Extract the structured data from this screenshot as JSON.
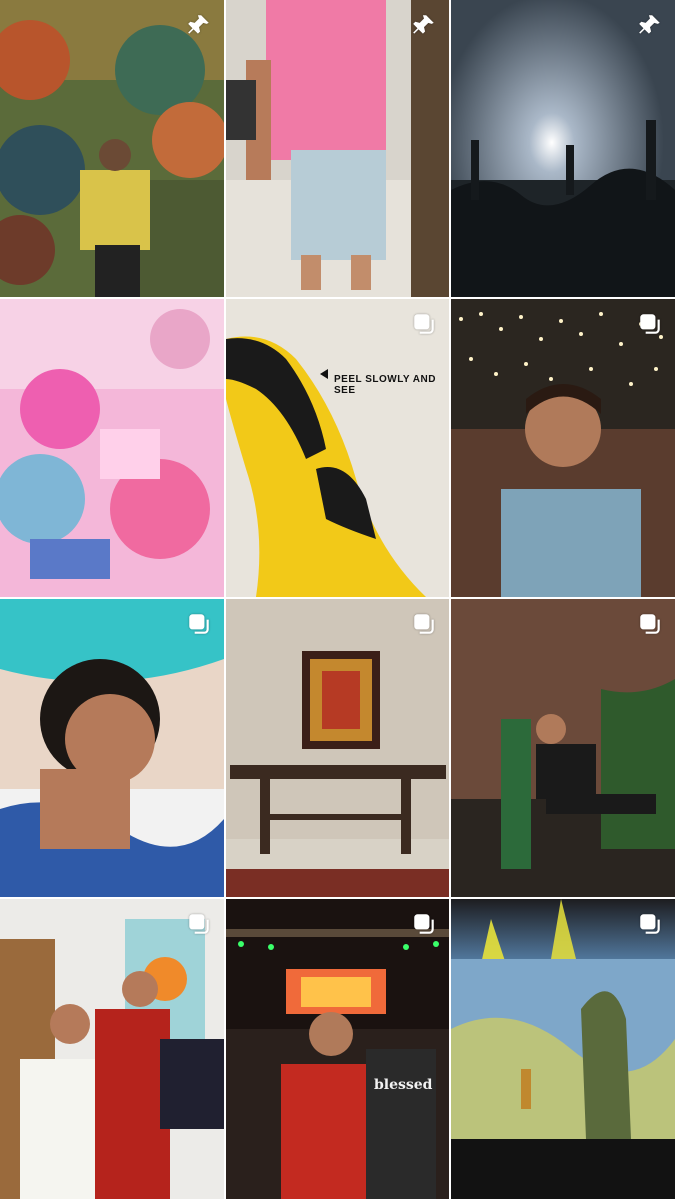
{
  "grid": {
    "posts": [
      {
        "id": "post-1",
        "pinned": true,
        "multi": false,
        "icon": "pin-icon"
      },
      {
        "id": "post-2",
        "pinned": true,
        "multi": false,
        "icon": "pin-icon"
      },
      {
        "id": "post-3",
        "pinned": true,
        "multi": false,
        "icon": "pin-icon"
      },
      {
        "id": "post-4",
        "pinned": false,
        "multi": false
      },
      {
        "id": "post-5",
        "pinned": false,
        "multi": true,
        "icon": "carousel-icon",
        "text": "PEEL SLOWLY AND SEE"
      },
      {
        "id": "post-6",
        "pinned": false,
        "multi": true,
        "icon": "carousel-icon"
      },
      {
        "id": "post-7",
        "pinned": false,
        "multi": true,
        "icon": "carousel-icon"
      },
      {
        "id": "post-8",
        "pinned": false,
        "multi": true,
        "icon": "carousel-icon"
      },
      {
        "id": "post-9",
        "pinned": false,
        "multi": true,
        "icon": "carousel-icon"
      },
      {
        "id": "post-10",
        "pinned": false,
        "multi": true,
        "icon": "carousel-icon"
      },
      {
        "id": "post-11",
        "pinned": false,
        "multi": true,
        "icon": "carousel-icon",
        "text": "blessed"
      },
      {
        "id": "post-12",
        "pinned": false,
        "multi": true,
        "icon": "carousel-icon"
      }
    ]
  },
  "colors": {
    "background": "#ffffff",
    "overlay_icon": "#ffffff",
    "banana_yellow": "#f2c918"
  }
}
